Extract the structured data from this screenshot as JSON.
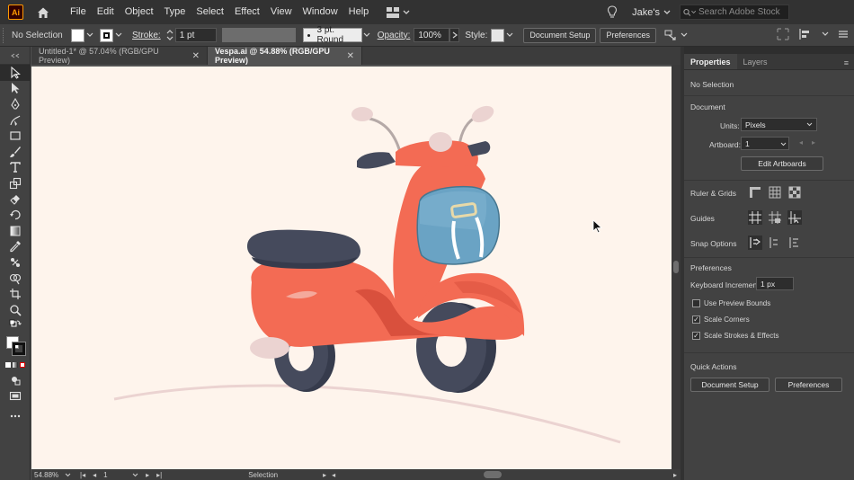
{
  "app": {
    "logo_text": "Ai"
  },
  "menu": {
    "items": [
      "File",
      "Edit",
      "Object",
      "Type",
      "Select",
      "Effect",
      "View",
      "Window",
      "Help"
    ],
    "user_name": "Jake's",
    "search_placeholder": "Search Adobe Stock"
  },
  "control_bar": {
    "selection_label": "No Selection",
    "stroke_label": "Stroke:",
    "stroke_weight": "1 pt",
    "brush_label": "3 pt. Round",
    "opacity_label": "Opacity:",
    "opacity_value": "100%",
    "style_label": "Style:",
    "document_setup_label": "Document Setup",
    "preferences_label": "Preferences"
  },
  "tabs": [
    {
      "title": "Untitled-1* @ 57.04% (RGB/GPU Preview)",
      "active": false
    },
    {
      "title": "Vespa.ai @ 54.88% (RGB/GPU Preview)",
      "active": true
    }
  ],
  "status_bar": {
    "zoom": "54.88%",
    "artboard_number": "1",
    "mode": "Selection"
  },
  "properties_panel": {
    "tabs": [
      "Properties",
      "Layers"
    ],
    "active_tab": "Properties",
    "selection_state": "No Selection",
    "document_heading": "Document",
    "units_label": "Units:",
    "units_value": "Pixels",
    "artboard_label": "Artboard:",
    "artboard_value": "1",
    "edit_artboards_label": "Edit Artboards",
    "ruler_grids_label": "Ruler & Grids",
    "guides_label": "Guides",
    "snap_options_label": "Snap Options",
    "preferences_heading": "Preferences",
    "keyboard_increment_label": "Keyboard Increment:",
    "keyboard_increment_value": "1 px",
    "checkboxes": [
      {
        "label": "Use Preview Bounds",
        "checked": false
      },
      {
        "label": "Scale Corners",
        "checked": true
      },
      {
        "label": "Scale Strokes & Effects",
        "checked": true
      }
    ],
    "quick_actions_heading": "Quick Actions",
    "document_setup_label": "Document Setup",
    "preferences_button_label": "Preferences"
  },
  "colors": {
    "artboard_bg": "#fef4ec",
    "scooter_body": "#f36b54",
    "scooter_shadow": "#d9503d",
    "seat": "#454a5c",
    "tire": "#454a5c",
    "bag": "#6aa3c4",
    "accent_pink": "#ebd3d1"
  }
}
